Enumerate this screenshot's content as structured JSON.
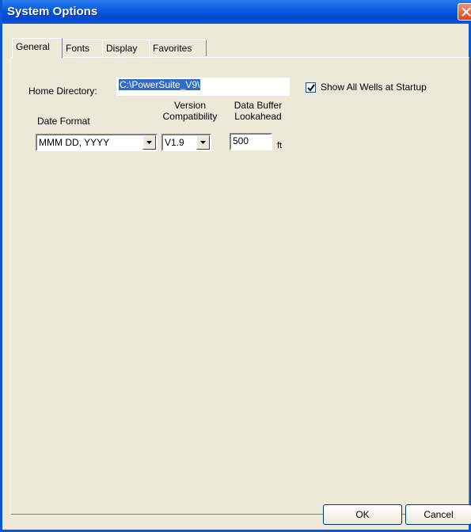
{
  "window": {
    "title": "System Options"
  },
  "tabs": [
    {
      "label": "General",
      "active": true
    },
    {
      "label": "Fonts",
      "active": false
    },
    {
      "label": "Display",
      "active": false
    },
    {
      "label": "Favorites",
      "active": false
    }
  ],
  "general": {
    "home_directory_label": "Home Directory:",
    "home_directory_value": "C:\\PowerSuite_V9\\",
    "show_all_wells_label": "Show All Wells at Startup",
    "show_all_wells_checked": true,
    "date_format_label": "Date Format",
    "date_format_value": "MMM DD, YYYY",
    "version_label_line1": "Version",
    "version_label_line2": "Compatibility",
    "version_value": "V1.9",
    "buffer_label_line1": "Data Buffer",
    "buffer_label_line2": "Lookahead",
    "buffer_value": "500",
    "buffer_unit": "ft"
  },
  "buttons": {
    "ok": "OK",
    "cancel": "Cancel"
  },
  "colors": {
    "titlebar": "#0a5ce0",
    "dialog_bg": "#ece9d8",
    "selection": "#316ac5"
  }
}
